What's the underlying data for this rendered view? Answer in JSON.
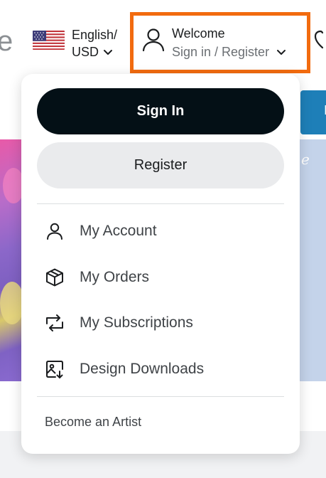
{
  "header": {
    "logo_fragment": "e",
    "language": {
      "line1": "English/",
      "line2": "USD",
      "flag_name": "us-flag"
    },
    "account": {
      "title": "Welcome",
      "subtitle": "Sign in / Register"
    },
    "highlight_color": "#f26b0f"
  },
  "background": {
    "right_script_fragment": "e",
    "blue_button_fragment": "I"
  },
  "dropdown": {
    "sign_in_label": "Sign In",
    "register_label": "Register",
    "items": [
      {
        "label": "My Account",
        "icon": "user-icon"
      },
      {
        "label": "My Orders",
        "icon": "box-icon"
      },
      {
        "label": "My Subscriptions",
        "icon": "repeat-icon"
      },
      {
        "label": "Design Downloads",
        "icon": "image-download-icon"
      }
    ],
    "become_artist_label": "Become an Artist"
  },
  "colors": {
    "primary_button": "#041016",
    "secondary_button": "#eaebed",
    "blue_accent": "#1e7fb8"
  }
}
